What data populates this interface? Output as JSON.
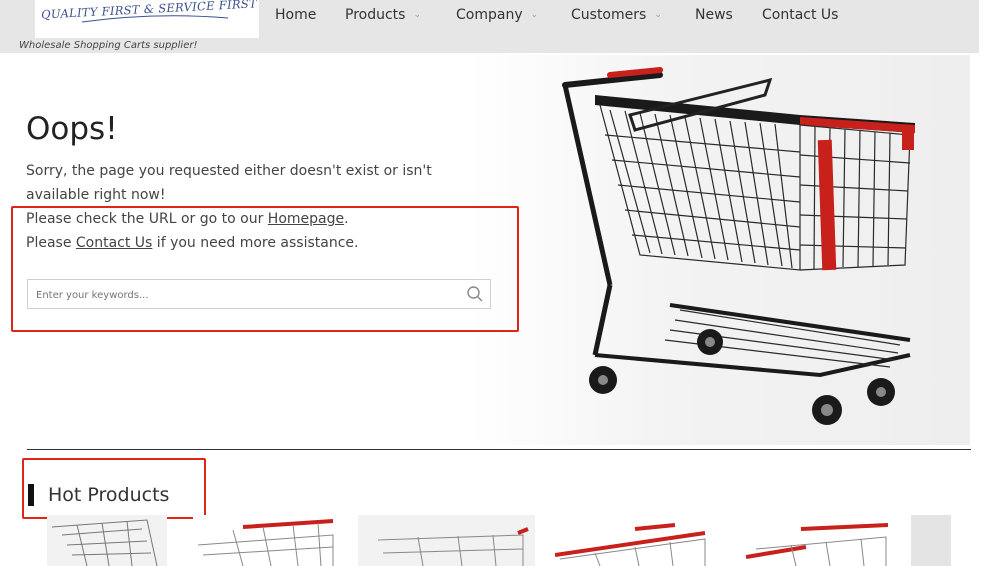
{
  "header": {
    "logo_text": "QUALITY FIRST & SERVICE FIRST",
    "tagline": "Wholesale Shopping Carts supplier!"
  },
  "nav": {
    "items": [
      {
        "label": "Home",
        "dropdown": false
      },
      {
        "label": "Products",
        "dropdown": true
      },
      {
        "label": "Company",
        "dropdown": true
      },
      {
        "label": "Customers",
        "dropdown": true
      },
      {
        "label": "News",
        "dropdown": false
      },
      {
        "label": "Contact Us",
        "dropdown": false
      }
    ]
  },
  "error": {
    "title": "Oops!",
    "line1": "Sorry, the page you requested either doesn't exist or isn't available right now!",
    "line2_prefix": "Please check the URL or go to our ",
    "homepage_link": "Homepage",
    "line2_suffix": ".",
    "line3_prefix": "Please ",
    "contact_link": "Contact Us",
    "line3_suffix": " if you need more assistance."
  },
  "search": {
    "placeholder": "Enter your keywords..."
  },
  "hot_products": {
    "title": "Hot Products"
  },
  "colors": {
    "highlight_box": "#e0241a",
    "header_bg": "#e6e6e6",
    "cart_red": "#c8201a"
  },
  "icons": {
    "search": "search-icon",
    "dropdown": "chevron-down-icon"
  }
}
